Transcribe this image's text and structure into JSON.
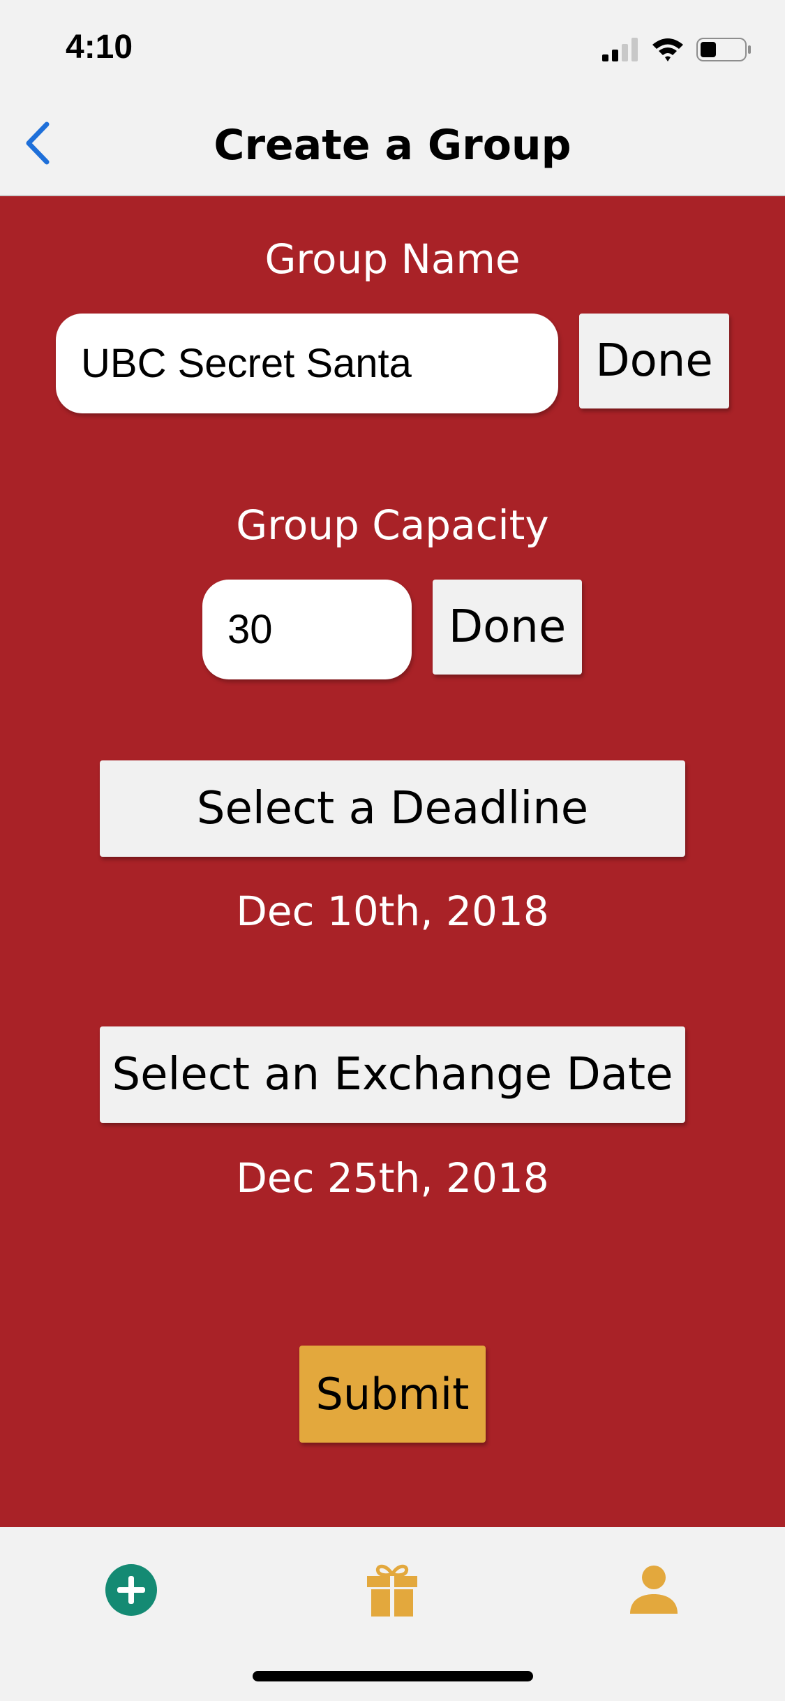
{
  "status_bar": {
    "time": "4:10"
  },
  "nav": {
    "title": "Create a Group",
    "back_icon": "chevron-left-icon"
  },
  "form": {
    "group_name": {
      "label": "Group Name",
      "value": "UBC Secret Santa",
      "done_label": "Done"
    },
    "group_capacity": {
      "label": "Group Capacity",
      "value": "30",
      "done_label": "Done"
    },
    "deadline": {
      "button_label": "Select a Deadline",
      "value": "Dec 10th, 2018"
    },
    "exchange_date": {
      "button_label": "Select an Exchange Date",
      "value": "Dec 25th, 2018"
    },
    "submit_label": "Submit"
  },
  "tab_bar": {
    "tabs": [
      {
        "icon": "plus-circle-icon",
        "color": "#148A73"
      },
      {
        "icon": "gift-icon",
        "color": "#E3A83D"
      },
      {
        "icon": "person-icon",
        "color": "#E3A83D"
      }
    ]
  },
  "colors": {
    "background_red": "#A92227",
    "accent_yellow": "#E3A83D",
    "accent_green": "#148A73",
    "nav_blue": "#1E6FD9"
  }
}
